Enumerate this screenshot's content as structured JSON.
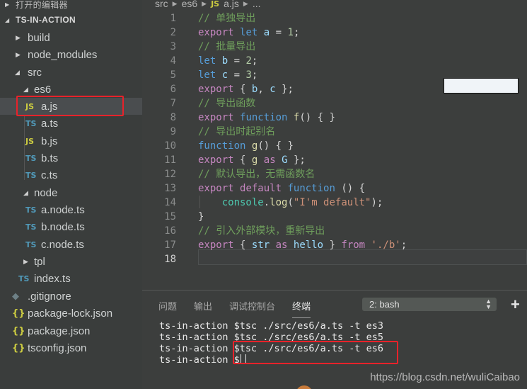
{
  "sidebar": {
    "open_editors_label": "打开的编辑器",
    "project_label": "TS-IN-ACTION",
    "items": [
      {
        "label": "build",
        "kind": "folder",
        "state": "collapsed"
      },
      {
        "label": "node_modules",
        "kind": "folder",
        "state": "collapsed"
      },
      {
        "label": "src",
        "kind": "folder",
        "state": "expanded"
      },
      {
        "label": "es6",
        "kind": "folder",
        "state": "expanded"
      },
      {
        "label": "a.js",
        "kind": "file",
        "icon": "JS",
        "selected": true
      },
      {
        "label": "a.ts",
        "kind": "file",
        "icon": "TS"
      },
      {
        "label": "b.js",
        "kind": "file",
        "icon": "JS"
      },
      {
        "label": "b.ts",
        "kind": "file",
        "icon": "TS"
      },
      {
        "label": "c.ts",
        "kind": "file",
        "icon": "TS"
      },
      {
        "label": "node",
        "kind": "folder",
        "state": "expanded"
      },
      {
        "label": "a.node.ts",
        "kind": "file",
        "icon": "TS"
      },
      {
        "label": "b.node.ts",
        "kind": "file",
        "icon": "TS"
      },
      {
        "label": "c.node.ts",
        "kind": "file",
        "icon": "TS"
      },
      {
        "label": "tpl",
        "kind": "folder",
        "state": "collapsed"
      },
      {
        "label": "index.ts",
        "kind": "file",
        "icon": "TS"
      },
      {
        "label": ".gitignore",
        "kind": "file",
        "icon": "git"
      },
      {
        "label": "package-lock.json",
        "kind": "file",
        "icon": "{}"
      },
      {
        "label": "package.json",
        "kind": "file",
        "icon": "{}"
      },
      {
        "label": "tsconfig.json",
        "kind": "file",
        "icon": "{}"
      }
    ]
  },
  "editor": {
    "breadcrumb": [
      "src",
      "es6",
      "a.js",
      "..."
    ],
    "breadcrumb_file_icon": "JS",
    "active_line": 18,
    "lines": [
      {
        "n": "1",
        "text": "// 单独导出"
      },
      {
        "n": "2",
        "text": "export let a = 1;"
      },
      {
        "n": "3",
        "text": "// 批量导出"
      },
      {
        "n": "4",
        "text": "let b = 2;"
      },
      {
        "n": "5",
        "text": "let c = 3;"
      },
      {
        "n": "6",
        "text": "export { b, c };"
      },
      {
        "n": "7",
        "text": "// 导出函数"
      },
      {
        "n": "8",
        "text": "export function f() { }"
      },
      {
        "n": "9",
        "text": "// 导出时起别名"
      },
      {
        "n": "10",
        "text": "function g() { }"
      },
      {
        "n": "11",
        "text": "export { g as G };"
      },
      {
        "n": "12",
        "text": "// 默认导出，无需函数名"
      },
      {
        "n": "13",
        "text": "export default function () {"
      },
      {
        "n": "14",
        "text": "    console.log(\"I'm default\");"
      },
      {
        "n": "15",
        "text": "}"
      },
      {
        "n": "16",
        "text": "// 引入外部模块，重新导出"
      },
      {
        "n": "17",
        "text": "export { str as hello } from './b';"
      },
      {
        "n": "18",
        "text": ""
      }
    ]
  },
  "panel": {
    "tabs": [
      "问题",
      "输出",
      "调试控制台",
      "终端"
    ],
    "active_tab": "终端",
    "terminal_select": "2: bash",
    "add_terminal_label": "+",
    "terminal_lines": [
      "ts-in-action $tsc ./src/es6/a.ts -t es3",
      "ts-in-action $tsc ./src/es6/a.ts -t es5",
      "ts-in-action $tsc ./src/es6/a.ts -t es6",
      "ts-in-action $"
    ]
  },
  "watermark": "https://blog.csdn.net/wuliCaibao",
  "colors": {
    "highlight_box": "#e8222a",
    "js_icon": "#cbcb41",
    "ts_icon": "#519aba",
    "comment": "#6f9f5c",
    "keyword": "#c586c0",
    "storage": "#569cd6"
  }
}
